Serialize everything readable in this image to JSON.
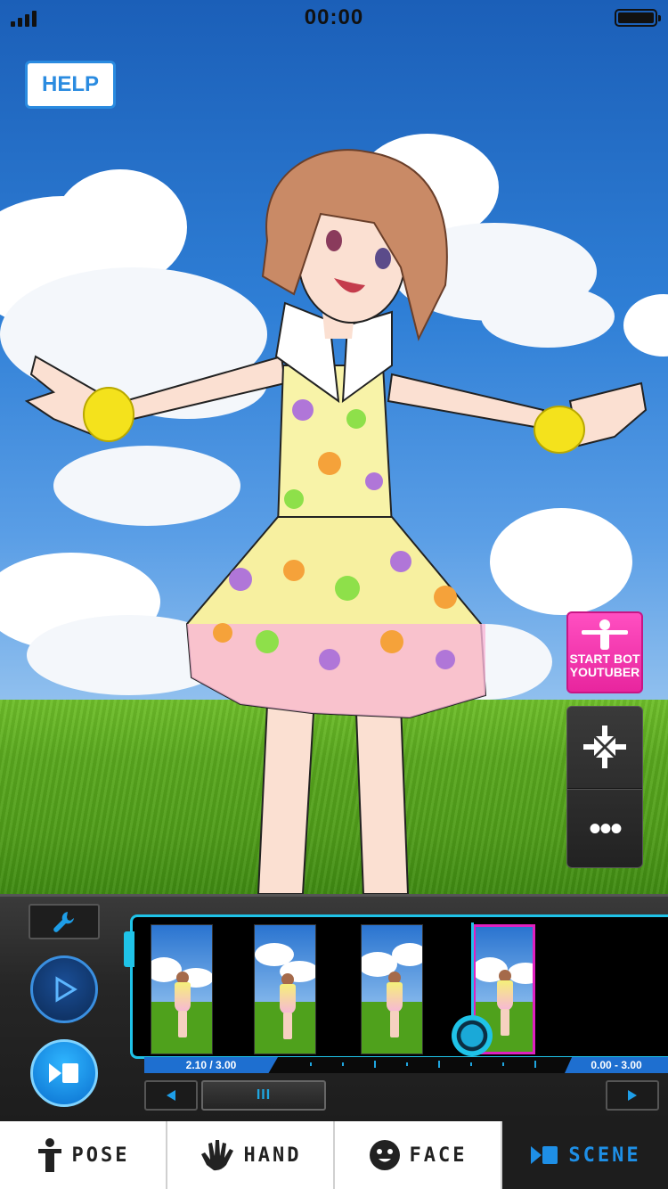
{
  "status_bar": {
    "time": "00:00"
  },
  "help_button": {
    "label": "HELP"
  },
  "start_bot_button": {
    "line1": "START BOT",
    "line2": "YOUTUBER"
  },
  "side_panel": {
    "more_label": "•••"
  },
  "timeline": {
    "left_time": "2.10 / 3.00",
    "right_time": "0.00 - 3.00",
    "scroll_label": "III",
    "frames": 4,
    "selected_frame": 4
  },
  "tabs": [
    {
      "label": "POSE",
      "icon": "person-icon"
    },
    {
      "label": "HAND",
      "icon": "hand-icon"
    },
    {
      "label": "FACE",
      "icon": "face-icon"
    },
    {
      "label": "SCENE",
      "icon": "scene-icon",
      "active": true
    }
  ],
  "colors": {
    "accent": "#1fc3e8",
    "help": "#2a8be0",
    "start_bot": "#ff4fc1",
    "selected_frame": "#e020c0",
    "active_tab": "#1e8fe6"
  }
}
